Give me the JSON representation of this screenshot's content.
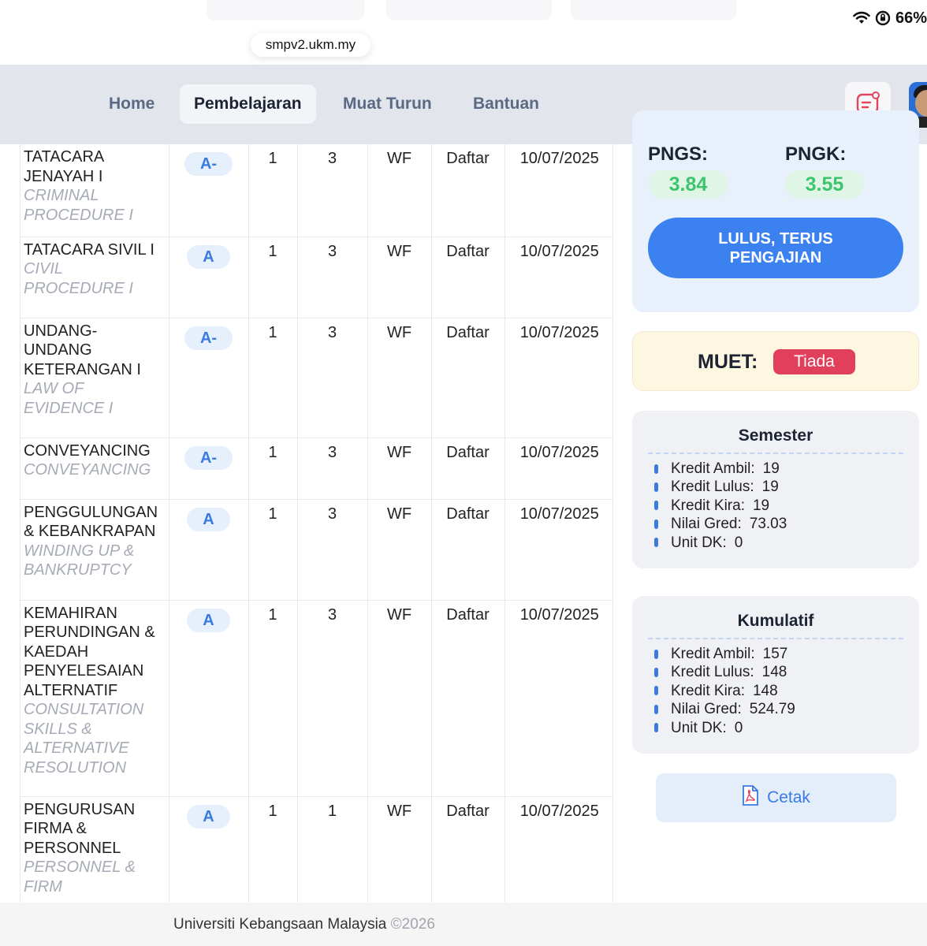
{
  "browser": {
    "url": "smpv2.ukm.my",
    "battery": "66%"
  },
  "nav": {
    "items": [
      {
        "label": "Home",
        "active": false
      },
      {
        "label": "Pembelajaran",
        "active": true
      },
      {
        "label": "Muat Turun",
        "active": false
      },
      {
        "label": "Bantuan",
        "active": false
      }
    ]
  },
  "courses": [
    {
      "ms": "TATACARA JENAYAH I",
      "en": "CRIMINAL PROCEDURE I",
      "grade": "A-",
      "c1": "1",
      "c2": "3",
      "mode": "WF",
      "status": "Daftar",
      "date": "10/07/2025"
    },
    {
      "ms": "TATACARA SIVIL I",
      "en": "CIVIL PROCEDURE I",
      "grade": "A",
      "c1": "1",
      "c2": "3",
      "mode": "WF",
      "status": "Daftar",
      "date": "10/07/2025"
    },
    {
      "ms": "UNDANG-UNDANG KETERANGAN I",
      "en": "LAW OF EVIDENCE I",
      "grade": "A-",
      "c1": "1",
      "c2": "3",
      "mode": "WF",
      "status": "Daftar",
      "date": "10/07/2025"
    },
    {
      "ms": "CONVEYANCING",
      "en": "CONVEYANCING",
      "grade": "A-",
      "c1": "1",
      "c2": "3",
      "mode": "WF",
      "status": "Daftar",
      "date": "10/07/2025"
    },
    {
      "ms": "PENGGULUNGAN & KEBANKRAPAN",
      "en": "WINDING UP & BANKRUPTCY",
      "grade": "A",
      "c1": "1",
      "c2": "3",
      "mode": "WF",
      "status": "Daftar",
      "date": "10/07/2025"
    },
    {
      "ms": "KEMAHIRAN PERUNDINGAN & KAEDAH PENYELESAIAN ALTERNATIF",
      "en": "CONSULTATION SKILLS & ALTERNATIVE RESOLUTION",
      "grade": "A",
      "c1": "1",
      "c2": "3",
      "mode": "WF",
      "status": "Daftar",
      "date": "10/07/2025"
    },
    {
      "ms": "PENGURUSAN FIRMA & PERSONNEL",
      "en": "PERSONNEL & FIRM",
      "grade": "A",
      "c1": "1",
      "c2": "1",
      "mode": "WF",
      "status": "Daftar",
      "date": "10/07/2025"
    }
  ],
  "gpa": {
    "pngs_label": "PNGS:",
    "pngs_value": "3.84",
    "pngk_label": "PNGK:",
    "pngk_value": "3.55",
    "status_line1": "LULUS, TERUS",
    "status_line2": "PENGAJIAN"
  },
  "muet": {
    "label": "MUET:",
    "value": "Tiada"
  },
  "semester": {
    "title": "Semester",
    "items": [
      {
        "label": "Kredit Ambil:",
        "value": "19"
      },
      {
        "label": "Kredit Lulus:",
        "value": "19"
      },
      {
        "label": "Kredit Kira:",
        "value": "19"
      },
      {
        "label": "Nilai Gred:",
        "value": "73.03"
      },
      {
        "label": "Unit DK:",
        "value": "0"
      }
    ]
  },
  "kumulatif": {
    "title": "Kumulatif",
    "items": [
      {
        "label": "Kredit Ambil:",
        "value": "157"
      },
      {
        "label": "Kredit Lulus:",
        "value": "148"
      },
      {
        "label": "Kredit Kira:",
        "value": "148"
      },
      {
        "label": "Nilai Gred:",
        "value": "524.79"
      },
      {
        "label": "Unit DK:",
        "value": "0"
      }
    ]
  },
  "print": {
    "label": "Cetak",
    "icon": "pdf-icon"
  },
  "footer": {
    "text": "Universiti Kebangsaan Malaysia",
    "year": "©2026"
  },
  "colors": {
    "accent": "#3b82f0",
    "grade_text": "#3b7be0",
    "gpa_green": "#3ec46d",
    "muet_red": "#e23f5b"
  }
}
